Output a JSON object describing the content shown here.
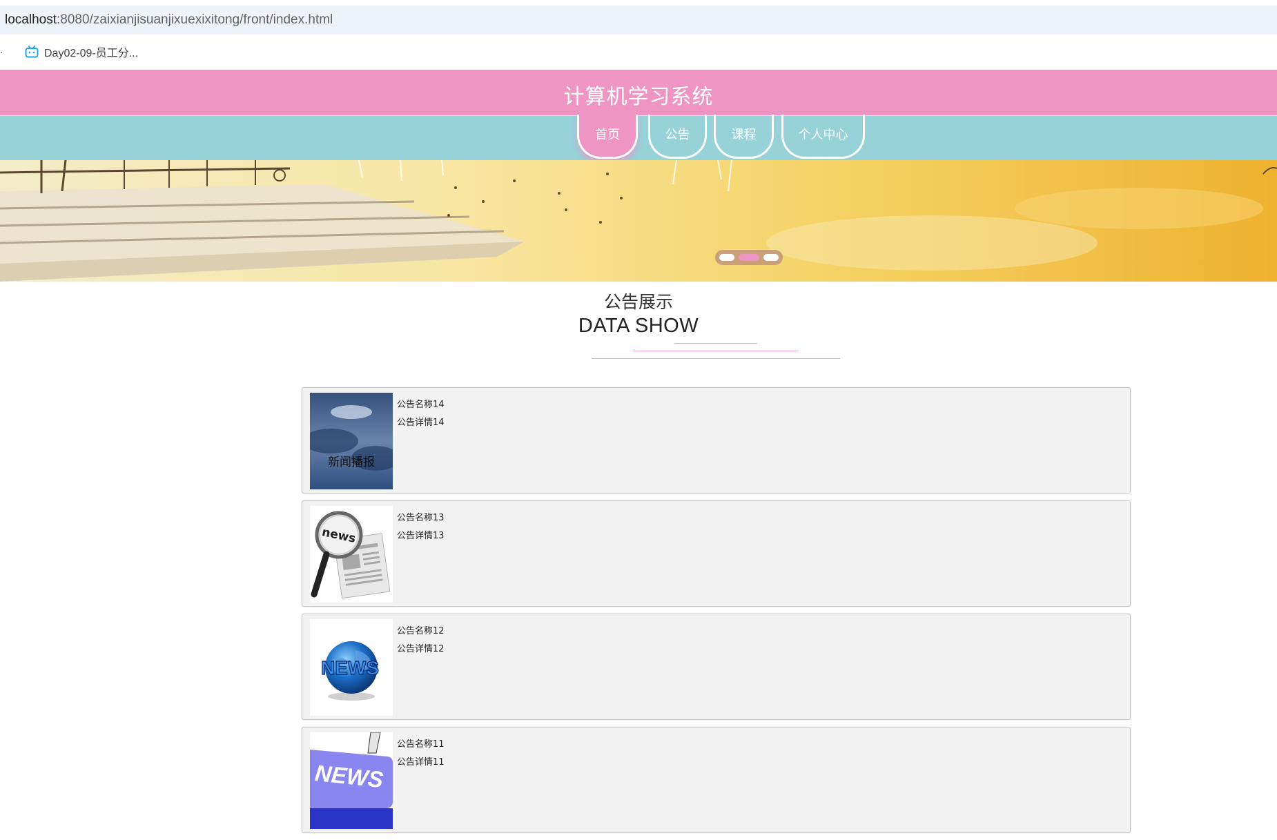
{
  "browser": {
    "url_host": "localhost",
    "url_rest": ":8080/zaixianjisuanjixuexixitong/front/index.html",
    "bookmark_dot": ".",
    "bookmark_label": "Day02-09-员工分..."
  },
  "header": {
    "title": "计算机学习系统"
  },
  "nav": {
    "items": [
      {
        "label": "首页",
        "active": true
      },
      {
        "label": "公告",
        "active": false
      },
      {
        "label": "课程",
        "active": false
      },
      {
        "label": "个人中心",
        "active": false
      }
    ]
  },
  "carousel": {
    "slide_count": 3,
    "active_index": 1
  },
  "section": {
    "title": "公告展示",
    "subtitle": "DATA SHOW"
  },
  "news": [
    {
      "name": "公告名称14",
      "detail": "公告详情14",
      "thumb_icon": "storm-sky-news-image",
      "thumb_text": "新闻播报"
    },
    {
      "name": "公告名称13",
      "detail": "公告详情13",
      "thumb_icon": "magnifier-newspaper-image",
      "thumb_text": "news"
    },
    {
      "name": "公告名称12",
      "detail": "公告详情12",
      "thumb_icon": "globe-news-image",
      "thumb_text": "NEWS"
    },
    {
      "name": "公告名称11",
      "detail": "公告详情11",
      "thumb_icon": "news-key-image",
      "thumb_text": "NEWS"
    }
  ]
}
